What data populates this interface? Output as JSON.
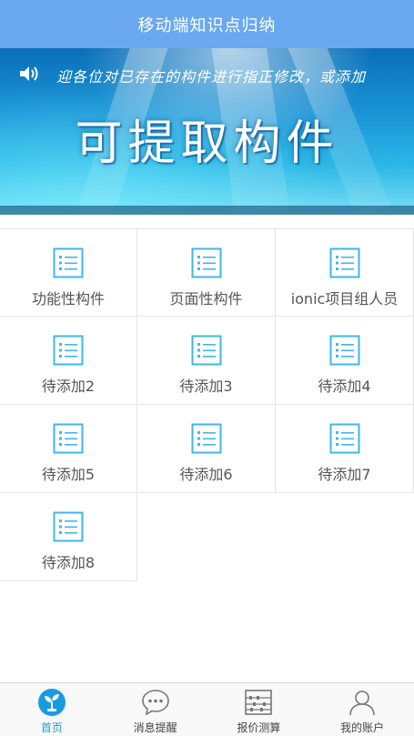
{
  "header": {
    "title": "移动端知识点归纳"
  },
  "banner": {
    "marquee_text": "迎各位对已存在的构件进行指正修改，或添加",
    "headline": "可提取构件"
  },
  "grid": {
    "items": [
      {
        "label": "功能性构件"
      },
      {
        "label": "页面性构件"
      },
      {
        "label": "ionic项目组人员"
      },
      {
        "label": "待添加2"
      },
      {
        "label": "待添加3"
      },
      {
        "label": "待添加4"
      },
      {
        "label": "待添加5"
      },
      {
        "label": "待添加6"
      },
      {
        "label": "待添加7"
      },
      {
        "label": "待添加8"
      }
    ]
  },
  "tabbar": {
    "accent_color": "#1a9be0",
    "tabs": [
      {
        "label": "首页",
        "icon": "home-sprout-icon",
        "active": true
      },
      {
        "label": "消息提醒",
        "icon": "chat-bubble-icon",
        "active": false
      },
      {
        "label": "报价测算",
        "icon": "abacus-icon",
        "active": false
      },
      {
        "label": "我的账户",
        "icon": "user-icon",
        "active": false
      }
    ]
  }
}
